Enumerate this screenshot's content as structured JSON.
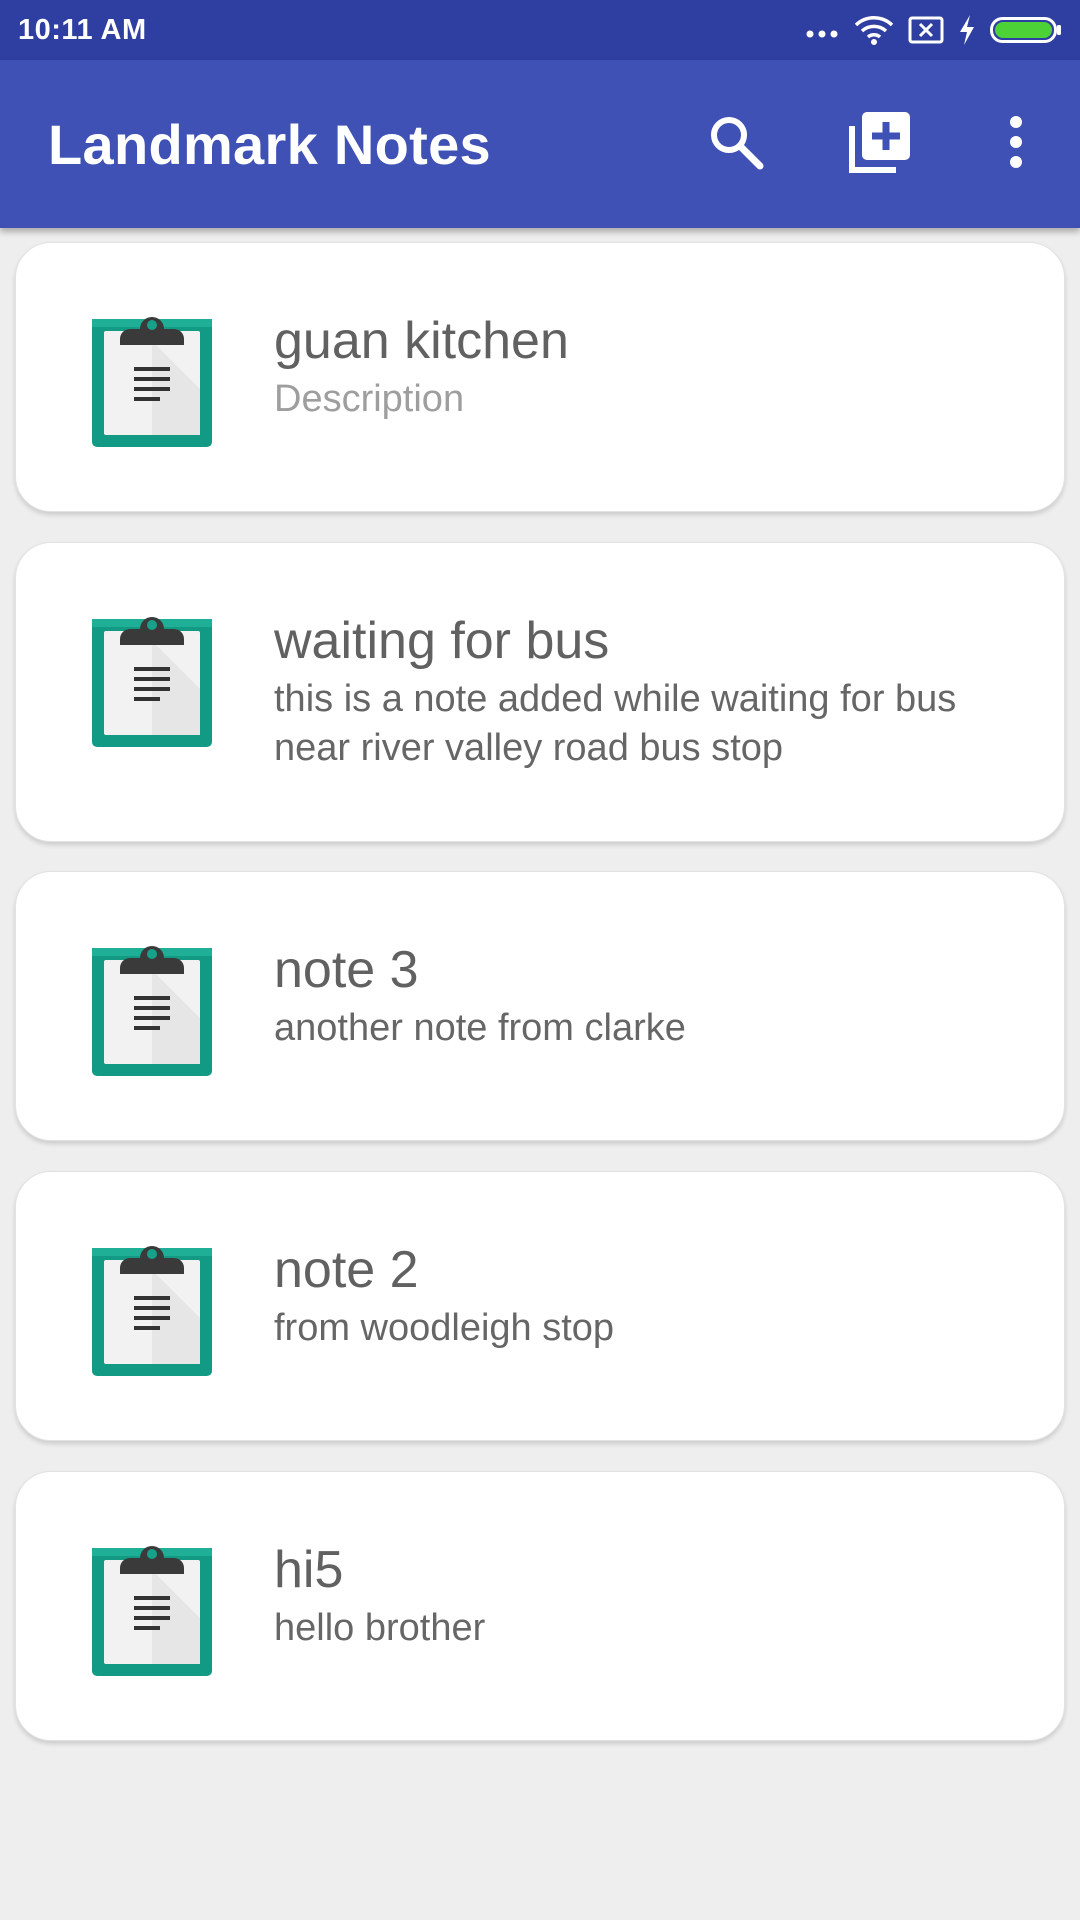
{
  "status_bar": {
    "time": "10:11 AM",
    "icons": [
      "more-dots-icon",
      "wifi-icon",
      "no-sim-icon",
      "charging-bolt-icon",
      "battery-icon"
    ],
    "battery_color": "#4cd137"
  },
  "app_bar": {
    "title": "Landmark Notes",
    "color": "#3f51b5",
    "actions": [
      "search-icon",
      "add-note-icon",
      "more-vert-icon"
    ]
  },
  "notes": [
    {
      "title": "guan kitchen",
      "description": "Description",
      "description_is_placeholder": true
    },
    {
      "title": "waiting for bus",
      "description": "this is a note added while waiting for bus near river valley road bus stop"
    },
    {
      "title": "note 3",
      "description": "another note from clarke"
    },
    {
      "title": "note 2",
      "description": "from woodleigh stop"
    },
    {
      "title": "hi5",
      "description": "hello brother"
    }
  ],
  "note_icon": "clipboard-note-icon",
  "icon_colors": {
    "board": "#17a08a",
    "clip": "#3a3a3a",
    "paper": "#f5f5f5"
  }
}
